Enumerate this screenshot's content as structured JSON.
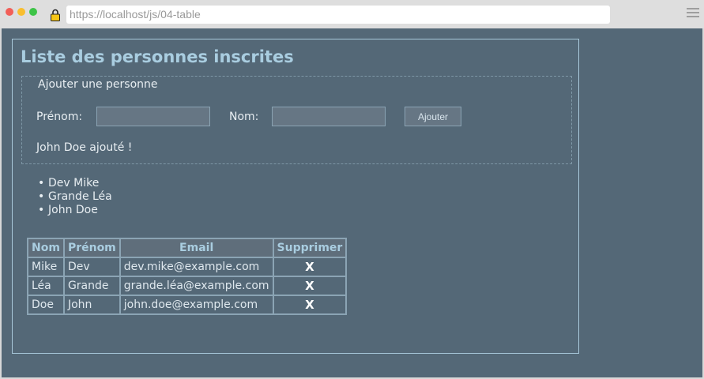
{
  "browser": {
    "url": "https://localhost/js/04-table"
  },
  "page": {
    "title": "Liste des personnes inscrites"
  },
  "form": {
    "legend": "Ajouter une personne",
    "firstname_label": "Prénom:",
    "lastname_label": "Nom:",
    "firstname_value": "",
    "lastname_value": "",
    "add_button": "Ajouter",
    "status": "John Doe ajouté !"
  },
  "list": {
    "items": [
      "Dev Mike",
      "Grande Léa",
      "John Doe"
    ]
  },
  "table": {
    "headers": [
      "Nom",
      "Prénom",
      "Email",
      "Supprimer"
    ],
    "rows": [
      {
        "nom": "Mike",
        "prenom": "Dev",
        "email": "dev.mike@example.com",
        "delete": "X"
      },
      {
        "nom": "Léa",
        "prenom": "Grande",
        "email": "grande.léa@example.com",
        "delete": "X"
      },
      {
        "nom": "Doe",
        "prenom": "John",
        "email": "john.doe@example.com",
        "delete": "X"
      }
    ]
  },
  "icons": {
    "lock": "lock-icon",
    "menu": "hamburger-menu-icon"
  },
  "colors": {
    "background": "#546877",
    "title": "#a9cde0",
    "border": "#8ba4b4"
  }
}
